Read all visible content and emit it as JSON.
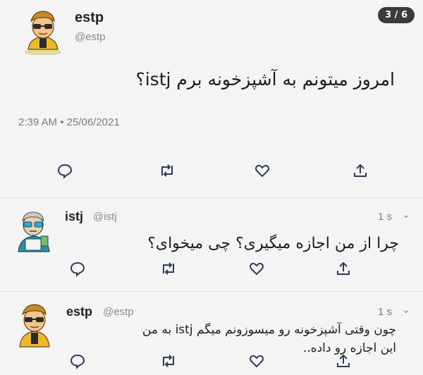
{
  "counter": "3 / 6",
  "main_tweet": {
    "name": "estp",
    "handle": "@estp",
    "text": "امروز میتونم به آشپزخونه برم istj؟",
    "timestamp": "2:39 AM • 25/06/2021"
  },
  "reply1": {
    "name": "istj",
    "handle": "@istj",
    "age": "1 s",
    "text": "چرا از من اجازه میگیری؟ چی میخوای؟"
  },
  "reply2": {
    "name": "estp",
    "handle": "@estp",
    "age": "1 s",
    "text_line1": "چون وقتی آشپزخونه رو میسوزونم میگم istj به من",
    "text_line2": "این اجازه رو داده.."
  },
  "icons": [
    "reply-icon",
    "retweet-icon",
    "like-icon",
    "share-icon",
    "avatar",
    "chevron-down-icon"
  ],
  "colors": {
    "background": "#f4f4f4",
    "counter_bg": "#3b3b3b",
    "text": "#1d1d1d",
    "muted": "#8a8a8a"
  }
}
